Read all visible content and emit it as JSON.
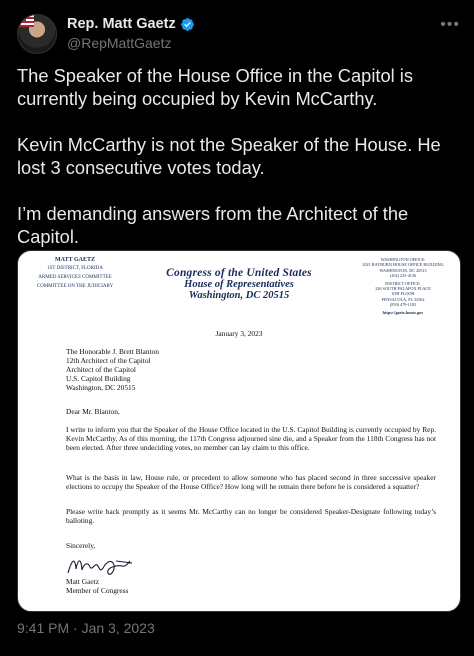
{
  "author": {
    "name": "Rep. Matt Gaetz",
    "handle": "@RepMattGaetz",
    "verified": true,
    "avatar_icon": "profile-photo",
    "more_icon": "more-icon"
  },
  "tweet": {
    "paragraphs": [
      "The Speaker of the House Office in the Capitol is currently being occupied by Kevin McCarthy.",
      "Kevin McCarthy is not the Speaker of the House. He lost 3 consecutive votes today.",
      "I’m demanding answers from the Architect of the Capitol."
    ],
    "timestamp": "9:41 PM · Jan 3, 2023"
  },
  "letter": {
    "left_header": {
      "name": "MATT GAETZ",
      "district": "1ST DISTRICT, FLORIDA",
      "committee1": "ARMED SERVICES COMMITTEE",
      "committee2": "COMMITTEE ON THE JUDICIARY"
    },
    "right_header": {
      "wash_title": "WASHINGTON OFFICE:",
      "wash_addr": "2021 RAYBURN HOUSE OFFICE BUILDING",
      "wash_city": "WASHINGTON, DC 20515",
      "wash_phone": "(202) 225-4136",
      "dist_title": "DISTRICT OFFICE:",
      "dist_addr": "226 SOUTH PALAFOX PLACE",
      "dist_floor": "6TH FLOOR",
      "dist_city": "PENSACOLA, FL 32502",
      "dist_phone": "(850) 479-1183",
      "website": "https://gaetz.house.gov"
    },
    "center_header": {
      "line1": "Congress of the United States",
      "line2": "House of Representatives",
      "line3": "Washington, DC 20515"
    },
    "date": "January 3, 2023",
    "address": [
      "The Honorable J. Brett Blanton",
      "12th Architect of the Capitol",
      "Architect of the Capitol",
      "U.S. Capitol Building",
      "Washington, DC 20515"
    ],
    "greeting": "Dear Mr. Blanton,",
    "body": [
      "I write to inform you that the Speaker of the House Office located in the U.S. Capitol Building is currently occupied by Rep. Kevin McCarthy. As of this morning, the 117th Congress adjourned sine die, and a Speaker from the 118th Congress has not been elected. After three undeciding votes, no member can lay claim to this office.",
      "What is the basis in law, House rule, or precedent to allow someone who has placed second in three successive speaker elections to occupy the Speaker of the House Office? How long will he remain there before he is considered a squatter?",
      "Please write back promptly as it seems Mr. McCarthy can no longer be considered Speaker-Designate following today’s balloting."
    ],
    "closing": "Sincerely,",
    "signature_name": "Matt Gaetz",
    "signature_title": "Member of Congress"
  }
}
